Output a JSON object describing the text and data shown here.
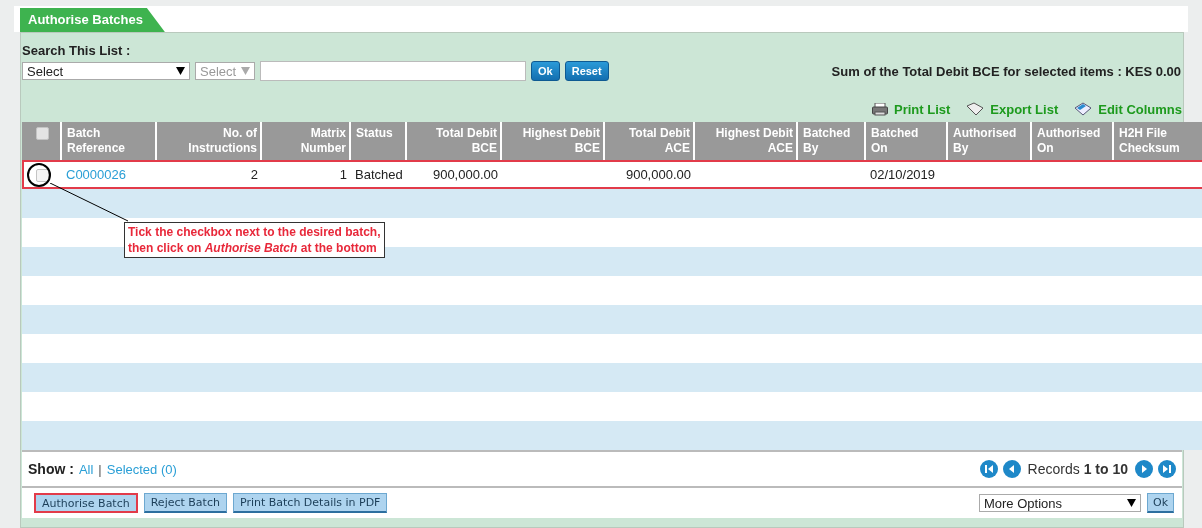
{
  "tab": {
    "label": "Authorise Batches",
    "selected": true
  },
  "search": {
    "label": "Search This List :",
    "field_select": {
      "value": "Select"
    },
    "operator_select": {
      "value": "Select",
      "disabled": true
    },
    "buttons": [
      "Ok",
      "Reset"
    ]
  },
  "sum_text": "Sum of the Total Debit BCE for selected items : KES 0.00",
  "actions": [
    {
      "label": "Print List",
      "kind": "print"
    },
    {
      "label": "Export List",
      "kind": "export"
    },
    {
      "label": "Edit Columns",
      "kind": "columns"
    }
  ],
  "table": {
    "select_all": {
      "checked": false
    },
    "columns": [
      "Batch\nReference",
      "No. of\nInstructions",
      "Matrix\nNumber",
      "Status",
      "Total Debit\nBCE",
      "Highest Debit\nBCE",
      "Total Debit\nACE",
      "Highest Debit\nACE",
      "Batched\nBy",
      "Batched\nOn",
      "Authorised\nBy",
      "Authorised\nOn",
      "H2H File\nChecksum"
    ],
    "rows": [
      {
        "checked": false,
        "highlighted": true,
        "cells": [
          "C0000026",
          "2",
          "1",
          "Batched",
          "900,000.00",
          null,
          "900,000.00",
          null,
          null,
          "02/10/2019",
          null,
          null,
          null
        ]
      }
    ]
  },
  "callout": {
    "text": "Tick the checkbox next to the desired batch,\nthen click on *Authorise Batch* at the bottom"
  },
  "show": {
    "label": "Show :",
    "options": [
      "All",
      "Selected (0)"
    ],
    "separator": "|"
  },
  "pager": {
    "text": "Records **1 to 10**"
  },
  "bottom_buttons": [
    {
      "label": "Authorise Batch",
      "highlighted": true
    },
    {
      "label": "Reject Batch",
      "highlighted": false
    },
    {
      "label": "Print Batch Details in PDF",
      "highlighted": false
    }
  ],
  "more_options": {
    "value": "More Options",
    "button": "Ok"
  }
}
